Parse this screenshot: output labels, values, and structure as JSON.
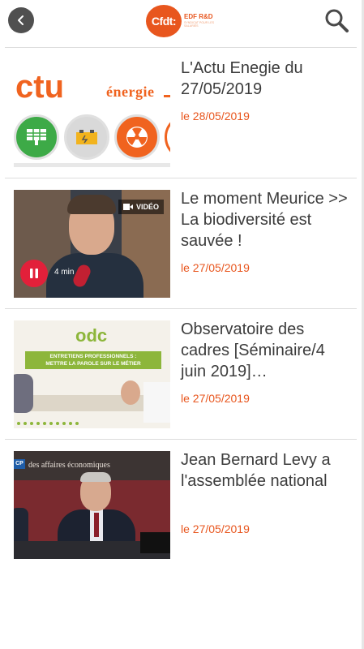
{
  "header": {
    "back_icon": "chevron-left-icon",
    "logo": {
      "word": "Cfdt:",
      "brand": "EDF R&D",
      "tagline": "SYNDICAT POUR LES SALARIÉS"
    },
    "search_icon": "search-icon"
  },
  "articles": [
    {
      "title": "L'Actu Enegie du 27/05/2019",
      "date": "le 28/05/2019",
      "thumb": {
        "word1": "ctu",
        "word2": "énergie"
      }
    },
    {
      "title": "Le moment Meurice >> La biodiversité est sauvée !",
      "date": "le 27/05/2019",
      "thumb": {
        "video_label": "VIDÉO",
        "duration": "4 min"
      }
    },
    {
      "title": "Observatoire des cadres [Séminaire/4 juin 2019]…",
      "date": "le 27/05/2019",
      "thumb": {
        "logo": "odc",
        "banner_line1": "ENTRETIENS PROFESSIONNELS :",
        "banner_line2": "METTRE LA PAROLE SUR LE MÉTIER"
      }
    },
    {
      "title": "Jean Bernard Levy a l'assemblée national",
      "date": "le 27/05/2019",
      "thumb": {
        "badge": "CP",
        "caption": "des affaires économiques"
      }
    }
  ],
  "colors": {
    "accent": "#e8561e",
    "text": "#3c3c3c",
    "divider": "#dcdcdc"
  }
}
